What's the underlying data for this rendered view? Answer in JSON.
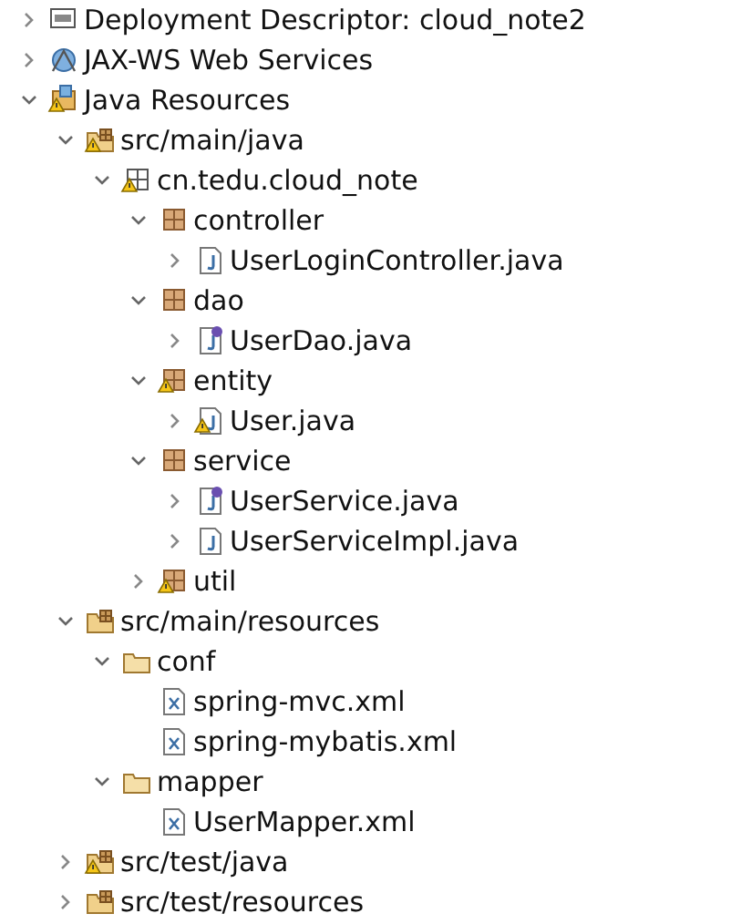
{
  "tree": [
    {
      "label": "Deployment Descriptor: cloud_note2",
      "kind": "descriptor",
      "expanded": false
    },
    {
      "label": "JAX-WS Web Services",
      "kind": "webservices",
      "expanded": false
    },
    {
      "label": "Java Resources",
      "kind": "java_resources",
      "expanded": true,
      "warning": true,
      "children": [
        {
          "label": "src/main/java",
          "kind": "source_folder",
          "expanded": true,
          "warning": true,
          "children": [
            {
              "label": "cn.tedu.cloud_note",
              "kind": "package_root",
              "expanded": true,
              "warning": true,
              "children": [
                {
                  "label": "controller",
                  "kind": "package",
                  "expanded": true,
                  "children": [
                    {
                      "label": "UserLoginController.java",
                      "kind": "java_class",
                      "expanded": false
                    }
                  ]
                },
                {
                  "label": "dao",
                  "kind": "package",
                  "expanded": true,
                  "children": [
                    {
                      "label": "UserDao.java",
                      "kind": "java_interface",
                      "expanded": false
                    }
                  ]
                },
                {
                  "label": "entity",
                  "kind": "package",
                  "expanded": true,
                  "warning": true,
                  "children": [
                    {
                      "label": "User.java",
                      "kind": "java_class",
                      "expanded": false,
                      "warning": true
                    }
                  ]
                },
                {
                  "label": "service",
                  "kind": "package",
                  "expanded": true,
                  "children": [
                    {
                      "label": "UserService.java",
                      "kind": "java_interface",
                      "expanded": false
                    },
                    {
                      "label": "UserServiceImpl.java",
                      "kind": "java_class",
                      "expanded": false
                    }
                  ]
                },
                {
                  "label": "util",
                  "kind": "package",
                  "expanded": false,
                  "warning": true
                }
              ]
            }
          ]
        },
        {
          "label": "src/main/resources",
          "kind": "source_folder",
          "expanded": true,
          "children": [
            {
              "label": "conf",
              "kind": "folder",
              "expanded": true,
              "children": [
                {
                  "label": "spring-mvc.xml",
                  "kind": "xml"
                },
                {
                  "label": "spring-mybatis.xml",
                  "kind": "xml"
                }
              ]
            },
            {
              "label": "mapper",
              "kind": "folder",
              "expanded": true,
              "children": [
                {
                  "label": "UserMapper.xml",
                  "kind": "xml"
                }
              ]
            }
          ]
        },
        {
          "label": "src/test/java",
          "kind": "source_folder",
          "expanded": false,
          "warning": true
        },
        {
          "label": "src/test/resources",
          "kind": "source_folder",
          "expanded": false
        }
      ]
    }
  ]
}
